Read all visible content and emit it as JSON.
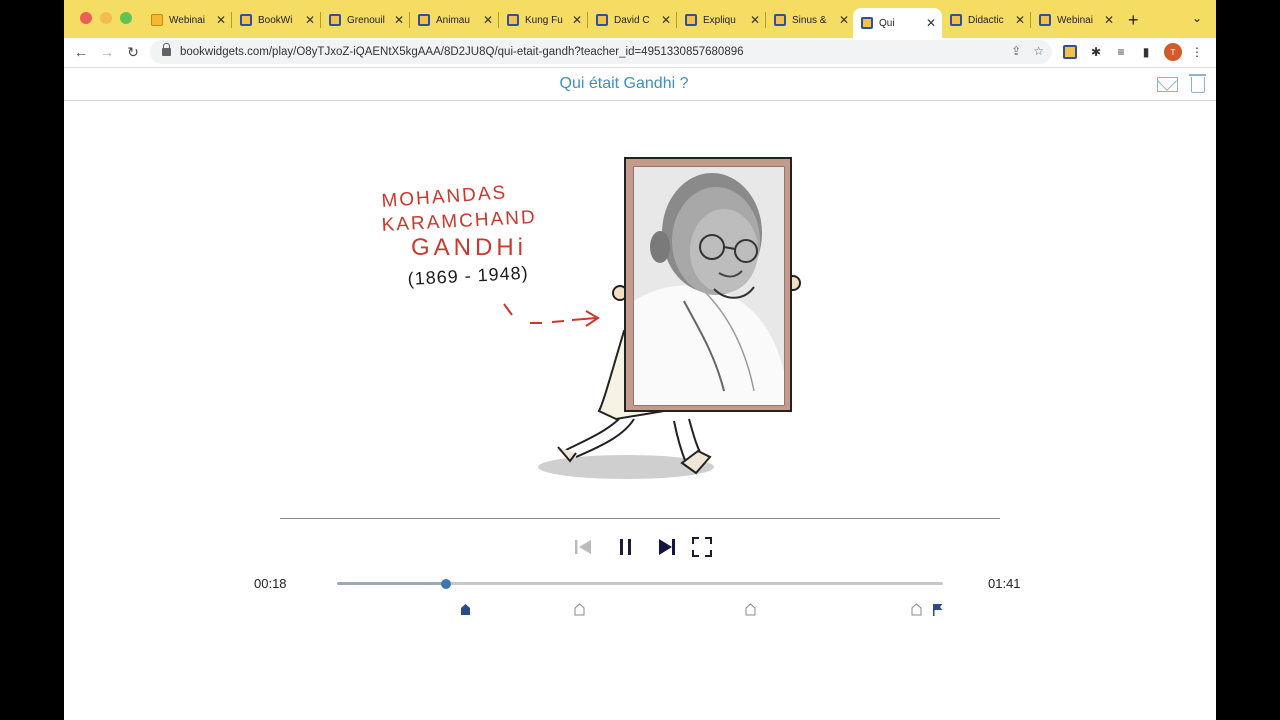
{
  "browser": {
    "tabs": [
      {
        "label": "Webinai",
        "icon": "webinar-icon",
        "active": false
      },
      {
        "label": "BookWi",
        "icon": "bookwidgets-icon",
        "active": false
      },
      {
        "label": "Grenouil",
        "icon": "bookwidgets-icon",
        "active": false
      },
      {
        "label": "Animau",
        "icon": "bookwidgets-icon",
        "active": false
      },
      {
        "label": "Kung Fu",
        "icon": "bookwidgets-icon",
        "active": false
      },
      {
        "label": "David C",
        "icon": "bookwidgets-icon",
        "active": false
      },
      {
        "label": "Expliqu",
        "icon": "bookwidgets-icon",
        "active": false
      },
      {
        "label": "Sinus &",
        "icon": "bookwidgets-icon",
        "active": false
      },
      {
        "label": "Qui",
        "icon": "bookwidgets-icon",
        "active": true
      },
      {
        "label": "Didactic",
        "icon": "bookwidgets-icon",
        "active": false
      },
      {
        "label": "Webinai",
        "icon": "bookwidgets-icon",
        "active": false
      }
    ],
    "url": "bookwidgets.com/play/O8yTJxoZ-iQAENtX5kgAAA/8D2JU8Q/qui-etait-gandh?teacher_id=4951330857680896",
    "avatar_initial": "T",
    "accent": "#f5dc62"
  },
  "app": {
    "title": "Qui était Gandhi ?",
    "title_color": "#3f8fbf"
  },
  "video": {
    "caption_name": [
      "MOHANDAS",
      "KARAMCHAND",
      "GANDHi"
    ],
    "caption_dates": "(1869 - 1948)"
  },
  "player": {
    "current_time": "00:18",
    "total_time": "01:41",
    "progress": 0.18,
    "markers": [
      {
        "position": 0.21,
        "type": "filled-house"
      },
      {
        "position": 0.398,
        "type": "house"
      },
      {
        "position": 0.68,
        "type": "house"
      },
      {
        "position": 0.955,
        "type": "house"
      },
      {
        "position": 0.99,
        "type": "flag"
      }
    ]
  }
}
